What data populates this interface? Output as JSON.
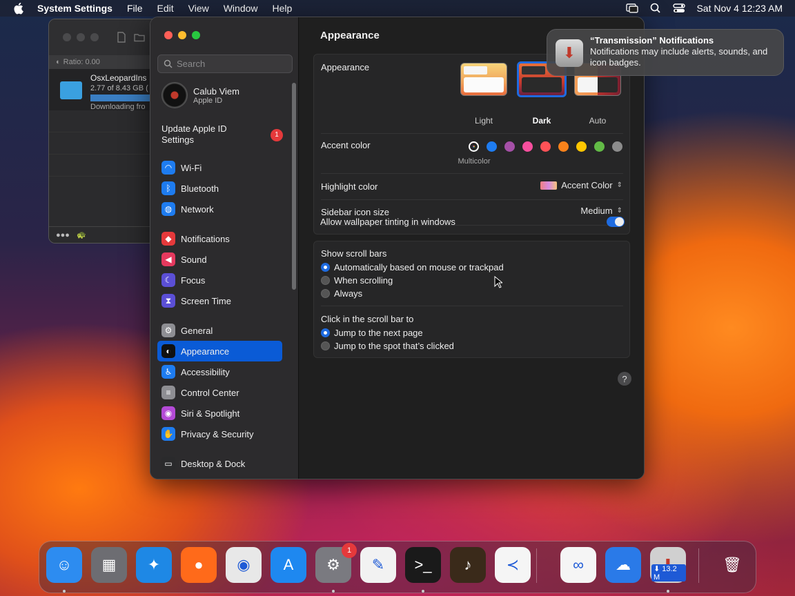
{
  "menubar": {
    "app_name": "System Settings",
    "menus": [
      "File",
      "Edit",
      "View",
      "Window",
      "Help"
    ],
    "datetime": "Sat Nov 4  12:23 AM"
  },
  "transmission": {
    "filter_text": "Ratio: 0.00",
    "torrent_name": "OsxLeopardIns",
    "torrent_size": "2.77 of 8.43 GB (",
    "torrent_status": "Downloading fro",
    "progress": 0.33
  },
  "settings": {
    "search_placeholder": "Search",
    "user": {
      "name": "Calub Viem",
      "subtitle": "Apple ID"
    },
    "update": {
      "label": "Update Apple ID Settings",
      "badge": "1"
    },
    "sidebar": [
      {
        "label": "Wi-Fi",
        "icon": "wifi-icon",
        "color": "#1e7cf0"
      },
      {
        "label": "Bluetooth",
        "icon": "bluetooth-icon",
        "color": "#1e7cf0"
      },
      {
        "label": "Network",
        "icon": "network-icon",
        "color": "#1e7cf0"
      },
      {
        "label": "Notifications",
        "icon": "bell-icon",
        "color": "#e5393b"
      },
      {
        "label": "Sound",
        "icon": "speaker-icon",
        "color": "#e5395e"
      },
      {
        "label": "Focus",
        "icon": "moon-icon",
        "color": "#5b4fd6"
      },
      {
        "label": "Screen Time",
        "icon": "hourglass-icon",
        "color": "#5b4fd6"
      },
      {
        "label": "General",
        "icon": "gear-icon",
        "color": "#8e8e93"
      },
      {
        "label": "Appearance",
        "icon": "appearance-icon",
        "color": "#111111"
      },
      {
        "label": "Accessibility",
        "icon": "accessibility-icon",
        "color": "#1e7cf0"
      },
      {
        "label": "Control Center",
        "icon": "control-center-icon",
        "color": "#8e8e93"
      },
      {
        "label": "Siri & Spotlight",
        "icon": "siri-icon",
        "color": "#b44ad6"
      },
      {
        "label": "Privacy & Security",
        "icon": "hand-icon",
        "color": "#1e7cf0"
      },
      {
        "label": "Desktop & Dock",
        "icon": "dock-icon",
        "color": "#2a2a2c"
      }
    ],
    "active_item": "Appearance",
    "main": {
      "title": "Appearance",
      "appearance_label": "Appearance",
      "themes": [
        "Light",
        "Dark",
        "Auto"
      ],
      "selected_theme": "Dark",
      "accent_label": "Accent color",
      "accent_colors": [
        "#d9d9d9",
        "#1e7cf0",
        "#a550a7",
        "#f74f9e",
        "#ff5257",
        "#f7821b",
        "#ffc600",
        "#62ba46",
        "#8c8c8c"
      ],
      "accent_selected_label": "Multicolor",
      "highlight_label": "Highlight color",
      "highlight_value": "Accent Color",
      "icon_size_label": "Sidebar icon size",
      "icon_size_value": "Medium",
      "tinting_label": "Allow wallpaper tinting in windows",
      "tinting_on": true,
      "scroll_label": "Show scroll bars",
      "scroll_options": [
        "Automatically based on mouse or trackpad",
        "When scrolling",
        "Always"
      ],
      "scroll_selected": 0,
      "click_label": "Click in the scroll bar to",
      "click_options": [
        "Jump to the next page",
        "Jump to the spot that’s clicked"
      ],
      "click_selected": 0,
      "help": "?"
    }
  },
  "notification": {
    "title": "“Transmission” Notifications",
    "body": "Notifications may include alerts, sounds, and icon badges."
  },
  "dock": {
    "apps": [
      {
        "name": "Finder",
        "icon": "finder-icon",
        "color": "#2d8cf0",
        "running": true
      },
      {
        "name": "Launchpad",
        "icon": "launchpad-icon",
        "color": "#6d6d72",
        "running": false
      },
      {
        "name": "Safari",
        "icon": "safari-icon",
        "color": "#1e88e5",
        "running": false
      },
      {
        "name": "Firefox",
        "icon": "firefox-icon",
        "color": "#ff6a1a",
        "running": false
      },
      {
        "name": "Chrome",
        "icon": "chrome-icon",
        "color": "#e8e8e8",
        "running": false
      },
      {
        "name": "App Store",
        "icon": "app-store-icon",
        "color": "#1e88f0",
        "running": false
      },
      {
        "name": "System Settings",
        "icon": "settings-icon",
        "color": "#7a7a80",
        "running": true,
        "badge": "1"
      },
      {
        "name": "TextEdit",
        "icon": "textedit-icon",
        "color": "#f2f2f2",
        "running": false
      },
      {
        "name": "Terminal",
        "icon": "terminal-icon",
        "color": "#1a1a1a",
        "running": true
      },
      {
        "name": "GarageBand",
        "icon": "garageband-icon",
        "color": "#3a2a1a",
        "running": false
      },
      {
        "name": "VS Code",
        "icon": "vscode-icon",
        "color": "#f5f5f5",
        "running": false
      },
      {
        "name": "Visual Studio",
        "icon": "visual-studio-icon",
        "color": "#f5f5f5",
        "running": false
      },
      {
        "name": "Weather",
        "icon": "weather-icon",
        "color": "#2a7ae8",
        "running": false
      },
      {
        "name": "Transmission",
        "icon": "transmission-icon",
        "color": "#d0d0d0",
        "running": true,
        "label": "⬇ 13.2 M"
      },
      {
        "name": "Trash",
        "icon": "trash-icon",
        "color": "#8a8a8e",
        "running": false
      }
    ]
  }
}
